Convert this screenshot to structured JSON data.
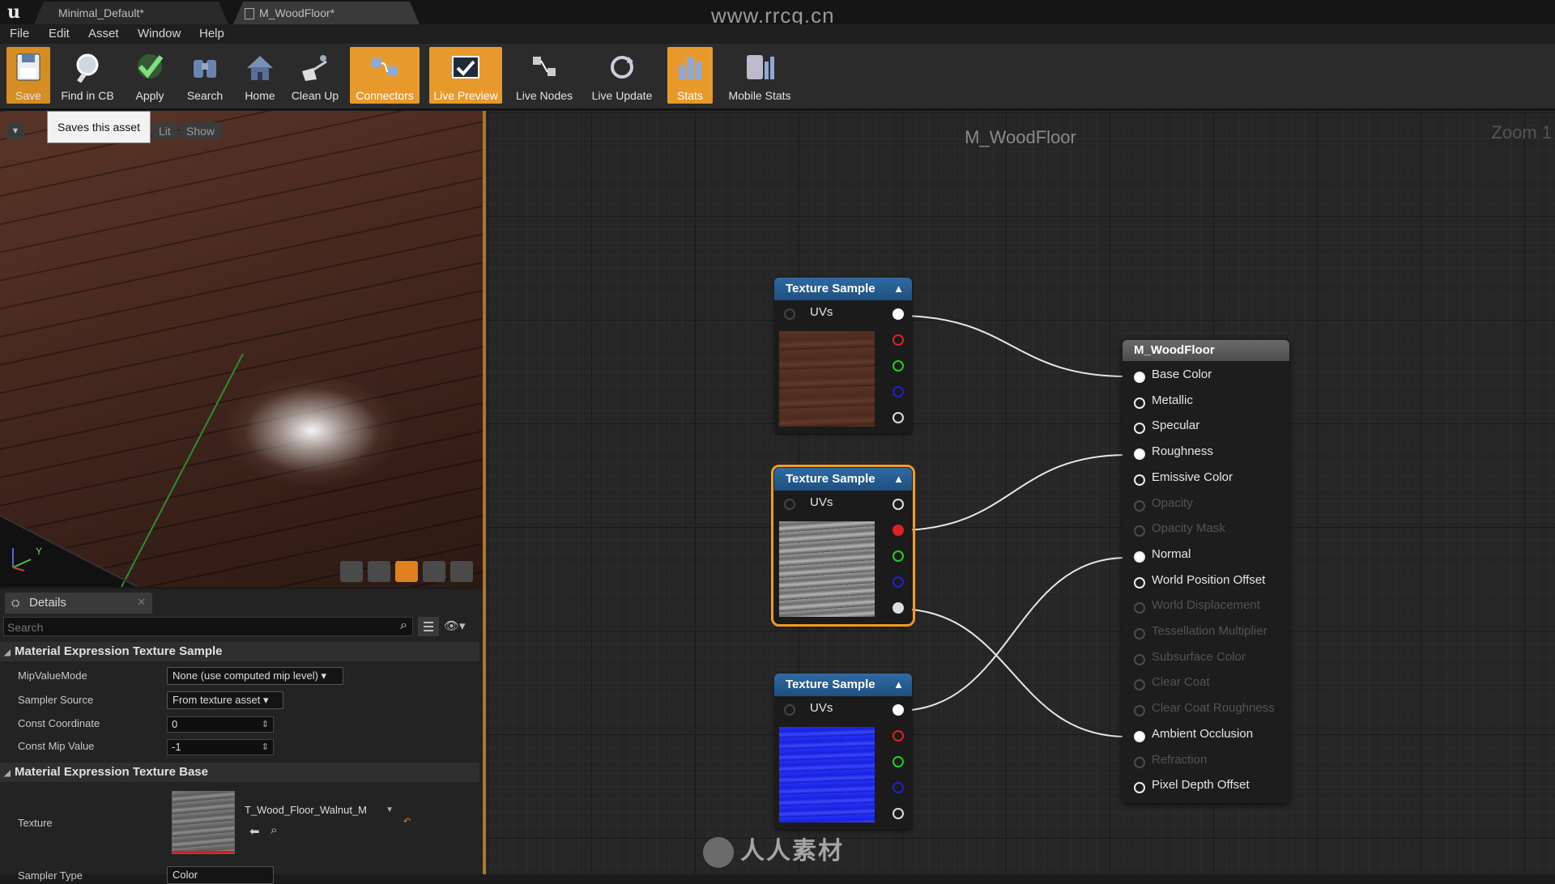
{
  "window": {
    "tabs": [
      {
        "label": "Minimal_Default*"
      },
      {
        "label": "M_WoodFloor*"
      }
    ],
    "watermark": "www.rrcg.cn"
  },
  "menu": [
    "File",
    "Edit",
    "Asset",
    "Window",
    "Help"
  ],
  "toolbar": [
    {
      "label": "Save",
      "icon": "save-icon",
      "active": true
    },
    {
      "label": "Find in CB",
      "icon": "find-icon",
      "active": false
    },
    {
      "label": "Apply",
      "icon": "check-icon",
      "active": false
    },
    {
      "label": "Search",
      "icon": "binoculars-icon",
      "active": false
    },
    {
      "label": "Home",
      "icon": "home-icon",
      "active": false
    },
    {
      "label": "Clean Up",
      "icon": "broom-icon",
      "active": false
    },
    {
      "label": "Connectors",
      "icon": "connectors-icon",
      "active": true
    },
    {
      "label": "Live Preview",
      "icon": "live-preview-icon",
      "active": true
    },
    {
      "label": "Live Nodes",
      "icon": "live-nodes-icon",
      "active": false
    },
    {
      "label": "Live Update",
      "icon": "live-update-icon",
      "active": false
    },
    {
      "label": "Stats",
      "icon": "stats-icon",
      "active": true
    },
    {
      "label": "Mobile Stats",
      "icon": "mobile-stats-icon",
      "active": false
    }
  ],
  "tooltip": "Saves this asset",
  "viewport": {
    "buttons": [
      "Lit",
      "Show"
    ],
    "axis_label": "Y"
  },
  "details": {
    "tab_title": "Details",
    "search_placeholder": "Search",
    "section1": "Material Expression Texture Sample",
    "props1": [
      {
        "label": "MipValueMode",
        "value": "None (use computed mip level)"
      },
      {
        "label": "Sampler Source",
        "value": "From texture asset"
      },
      {
        "label": "Const Coordinate",
        "value": "0"
      },
      {
        "label": "Const Mip Value",
        "value": "-1"
      }
    ],
    "section2": "Material Expression Texture Base",
    "texture_label": "Texture",
    "texture_value": "T_Wood_Floor_Walnut_M",
    "sampler_type_label": "Sampler Type",
    "sampler_type_value": "Color"
  },
  "graph": {
    "title": "M_WoodFloor",
    "zoom": "Zoom 1",
    "texture_nodes": [
      {
        "title": "Texture Sample",
        "input": "UVs",
        "preview": "wood-diffuse"
      },
      {
        "title": "Texture Sample",
        "input": "UVs",
        "preview": "wood-roughness"
      },
      {
        "title": "Texture Sample",
        "input": "UVs",
        "preview": "wood-normal"
      }
    ],
    "result_node": {
      "title": "M_WoodFloor",
      "inputs": [
        {
          "label": "Base Color",
          "enabled": true,
          "connected": true
        },
        {
          "label": "Metallic",
          "enabled": true,
          "connected": false
        },
        {
          "label": "Specular",
          "enabled": true,
          "connected": false
        },
        {
          "label": "Roughness",
          "enabled": true,
          "connected": true
        },
        {
          "label": "Emissive Color",
          "enabled": true,
          "connected": false
        },
        {
          "label": "Opacity",
          "enabled": false,
          "connected": false
        },
        {
          "label": "Opacity Mask",
          "enabled": false,
          "connected": false
        },
        {
          "label": "Normal",
          "enabled": true,
          "connected": true
        },
        {
          "label": "World Position Offset",
          "enabled": true,
          "connected": false
        },
        {
          "label": "World Displacement",
          "enabled": false,
          "connected": false
        },
        {
          "label": "Tessellation Multiplier",
          "enabled": false,
          "connected": false
        },
        {
          "label": "Subsurface Color",
          "enabled": false,
          "connected": false
        },
        {
          "label": "Clear Coat",
          "enabled": false,
          "connected": false
        },
        {
          "label": "Clear Coat Roughness",
          "enabled": false,
          "connected": false
        },
        {
          "label": "Ambient Occlusion",
          "enabled": true,
          "connected": true
        },
        {
          "label": "Refraction",
          "enabled": false,
          "connected": false
        },
        {
          "label": "Pixel Depth Offset",
          "enabled": true,
          "connected": false
        }
      ]
    }
  },
  "bottom_watermark": "人人素材",
  "colors": {
    "accent": "#e79a2b",
    "node_header": "#2f6aa2",
    "selection": "#f29b20"
  }
}
